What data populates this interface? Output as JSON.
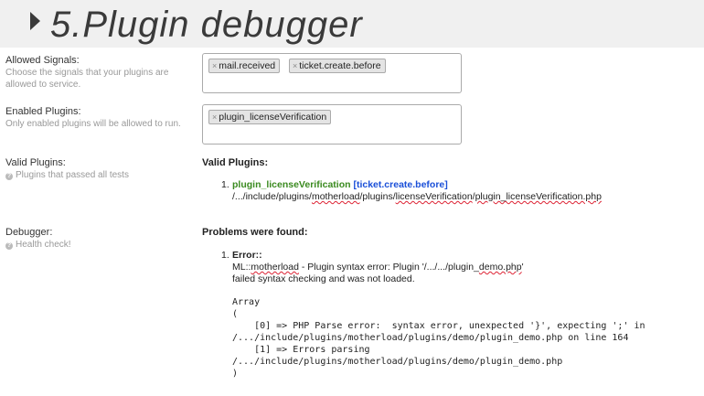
{
  "banner": {
    "title": "5.Plugin debugger"
  },
  "fields": {
    "allowed_signals": {
      "label": "Allowed Signals:",
      "desc": "Choose the signals that your plugins are allowed to service.",
      "chips": [
        "mail.received",
        "ticket.create.before"
      ]
    },
    "enabled_plugins": {
      "label": "Enabled Plugins:",
      "desc": "Only enabled plugins will be allowed to run.",
      "chips": [
        "plugin_licenseVerification"
      ]
    },
    "valid_plugins": {
      "label": "Valid Plugins:",
      "desc": "Plugins that passed all tests",
      "heading": "Valid Plugins:",
      "item_number": "1.",
      "plugin_name": "plugin_licenseVerification",
      "signal": "[ticket.create.before]",
      "path_parts": [
        "/.../include/plugins/",
        "motherload",
        "/plugins/",
        "licenseVerification",
        "/",
        "plugin_licenseVerification.php"
      ]
    },
    "debugger": {
      "label": "Debugger:",
      "desc": "Health check!",
      "heading": "Problems were found:",
      "item_number": "1.",
      "error_title": "Error::",
      "error_line1_parts": [
        "ML::",
        "motherload",
        " - Plugin syntax error: Plugin '/.../.../plugin_",
        "demo.php",
        "'"
      ],
      "error_line2": "failed syntax checking and was not loaded.",
      "array_lines": [
        "Array",
        "(",
        "    [0] => PHP Parse error:  syntax error, unexpected '}', expecting ';' in",
        "/.../include/plugins/motherload/plugins/demo/plugin_demo.php on line 164",
        "    [1] => Errors parsing",
        "/.../include/plugins/motherload/plugins/demo/plugin_demo.php",
        ")"
      ]
    }
  },
  "colors": {
    "plugin_name": "#3a8a1f",
    "signal": "#1a4fd8",
    "banner_bg": "#f0f0f0"
  },
  "icons": {
    "chip_remove": "×",
    "help": "?"
  }
}
